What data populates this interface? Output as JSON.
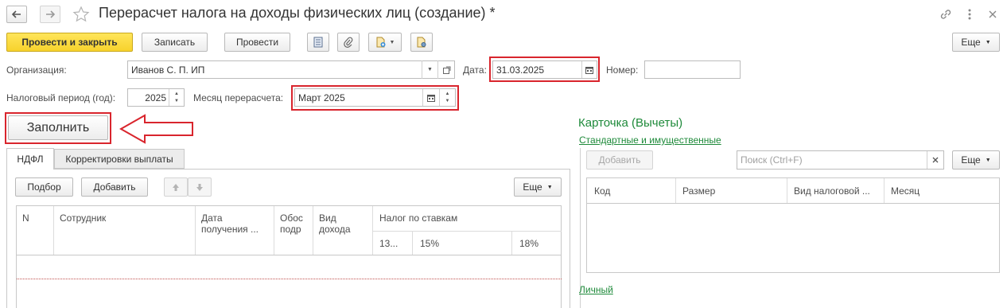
{
  "window": {
    "title": "Перерасчет налога на доходы физических лиц (создание) *"
  },
  "toolbar": {
    "post_close": "Провести и закрыть",
    "save": "Записать",
    "post": "Провести",
    "more": "Еще"
  },
  "form": {
    "org_label": "Организация:",
    "org_value": "Иванов С. П. ИП",
    "date_label": "Дата:",
    "date_value": "31.03.2025",
    "number_label": "Номер:",
    "number_value": "",
    "period_label": "Налоговый период (год):",
    "period_value": "2025",
    "month_label": "Месяц перерасчета:",
    "month_value": "Март 2025"
  },
  "fill_button": "Заполнить",
  "tabs": [
    {
      "label": "НДФЛ"
    },
    {
      "label": "Корректировки выплаты"
    }
  ],
  "ndfl_toolbar": {
    "select": "Подбор",
    "add": "Добавить",
    "more": "Еще"
  },
  "table": {
    "col_n": "N",
    "col_employee": "Сотрудник",
    "col_date": "Дата получения ...",
    "col_obos": "Обос подр",
    "col_income_type": "Вид дохода",
    "col_tax_rates": "Налог по ставкам",
    "sub_13": "13...",
    "sub_15": "15%",
    "sub_18": "18%"
  },
  "card": {
    "title": "Карточка (Вычеты)",
    "link_standard": "Стандартные и имущественные",
    "add": "Добавить",
    "search_placeholder": "Поиск (Ctrl+F)",
    "more": "Еще",
    "col_code": "Код",
    "col_size": "Размер",
    "col_tax_type": "Вид налоговой ...",
    "col_month": "Месяц",
    "link_personal": "Личный"
  },
  "colors": {
    "accent_red": "#d9252d",
    "link_green": "#1e8a3a",
    "primary_yellow": "#f7d22c"
  }
}
